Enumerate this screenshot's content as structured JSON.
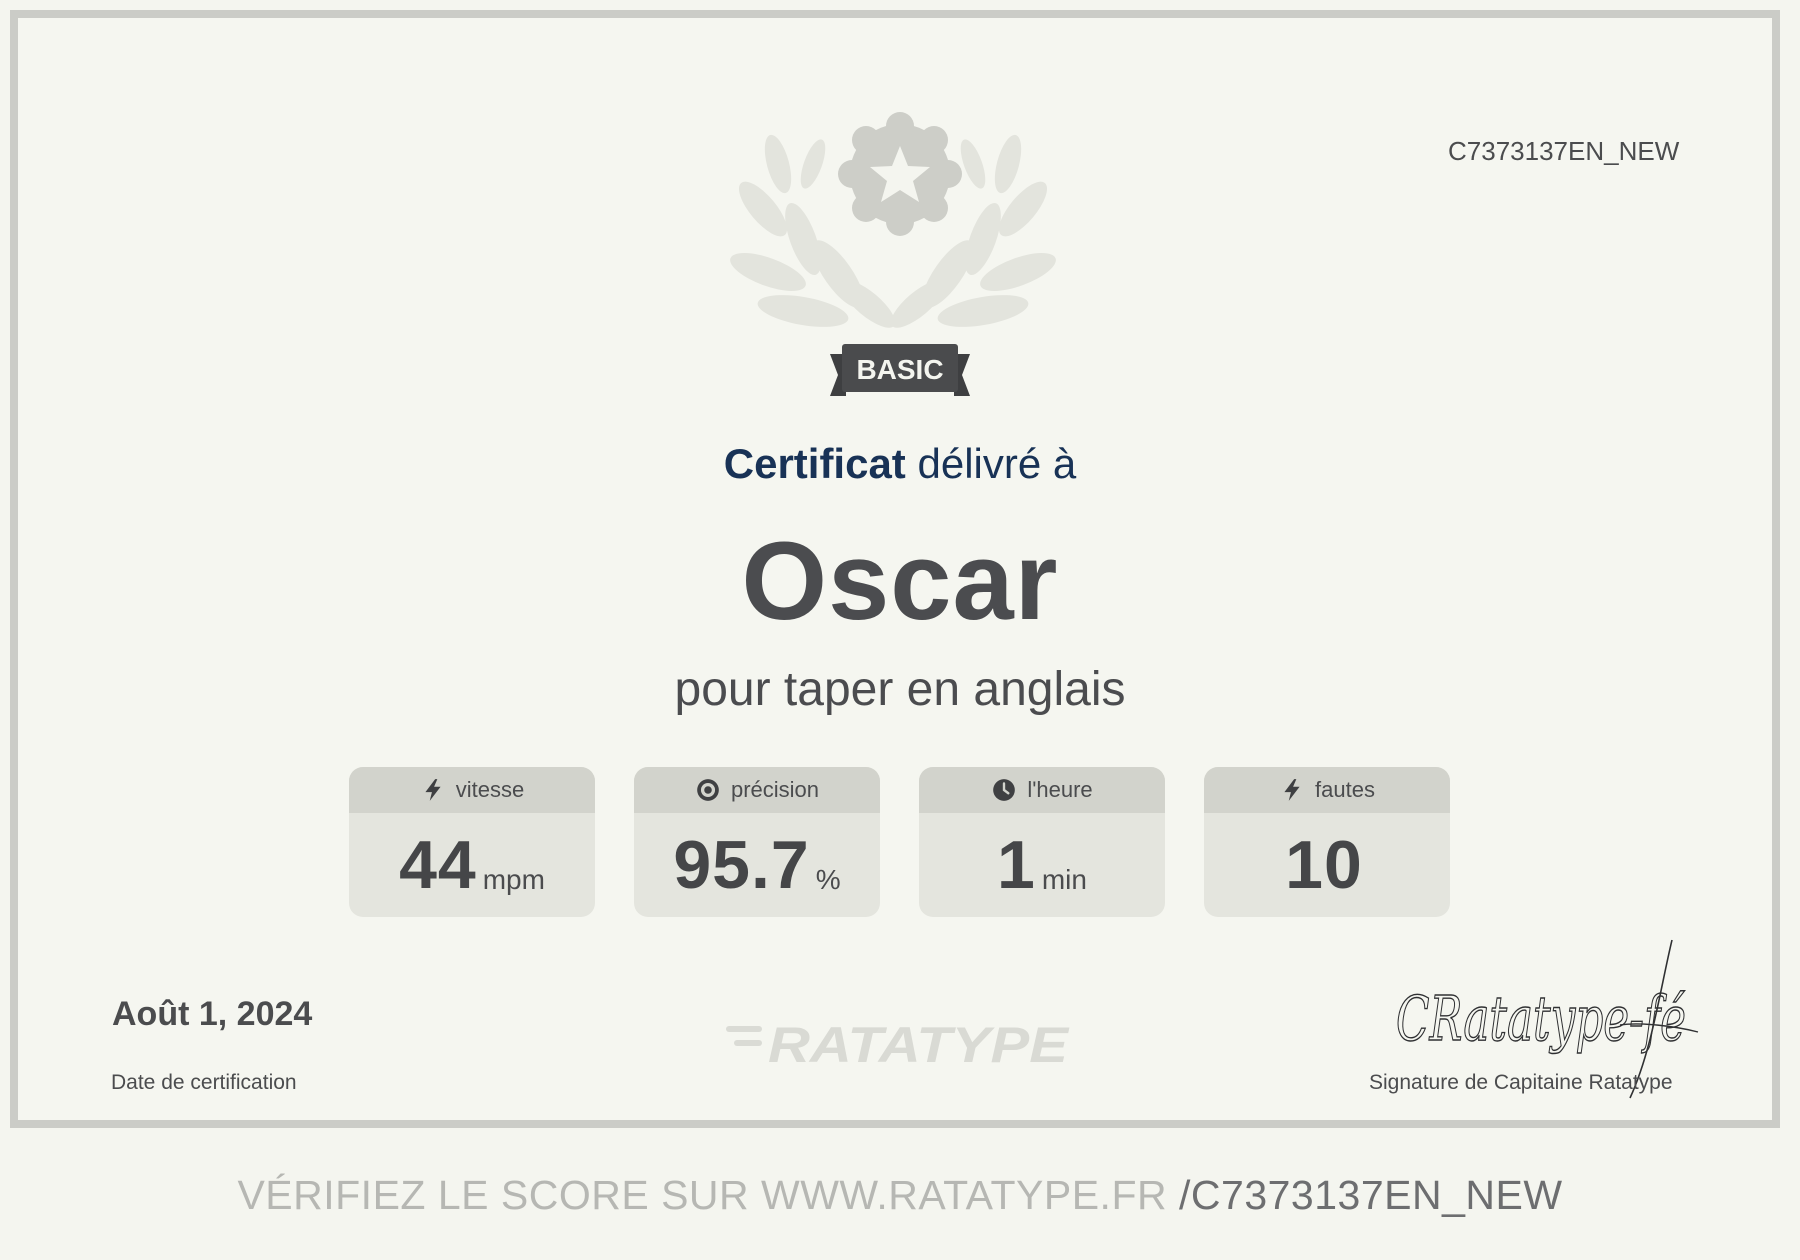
{
  "certificate": {
    "id": "C7373137EN_NEW",
    "level_badge": "BASIC",
    "heading_bold": "Certificat",
    "heading_rest": "délivré à",
    "recipient": "Oscar",
    "subtitle": "pour taper en anglais"
  },
  "stats": [
    {
      "label": "vitesse",
      "icon": "lightning-icon",
      "value": "44",
      "unit": "mpm"
    },
    {
      "label": "précision",
      "icon": "target-icon",
      "value": "95.7",
      "unit": "%"
    },
    {
      "label": "l'heure",
      "icon": "clock-icon",
      "value": "1",
      "unit": "min"
    },
    {
      "label": "fautes",
      "icon": "lightning-icon",
      "value": "10",
      "unit": ""
    }
  ],
  "footer": {
    "date": "Août 1, 2024",
    "date_label": "Date de certification",
    "brand": "RATATYPE",
    "signature_text": "CRatatype-fé",
    "signature_label": "Signature de Capitaine Ratatype",
    "verify_prefix": "VÉRIFIEZ LE SCORE SUR WWW.RATATYPE.FR",
    "verify_id": "/C7373137EN_NEW"
  },
  "colors": {
    "background": "#f4f5ef",
    "frame": "#cbccc7",
    "heading": "#183256",
    "text": "#4b4c4f",
    "stat_card": "#e4e5de",
    "stat_head": "#d2d3cc"
  }
}
